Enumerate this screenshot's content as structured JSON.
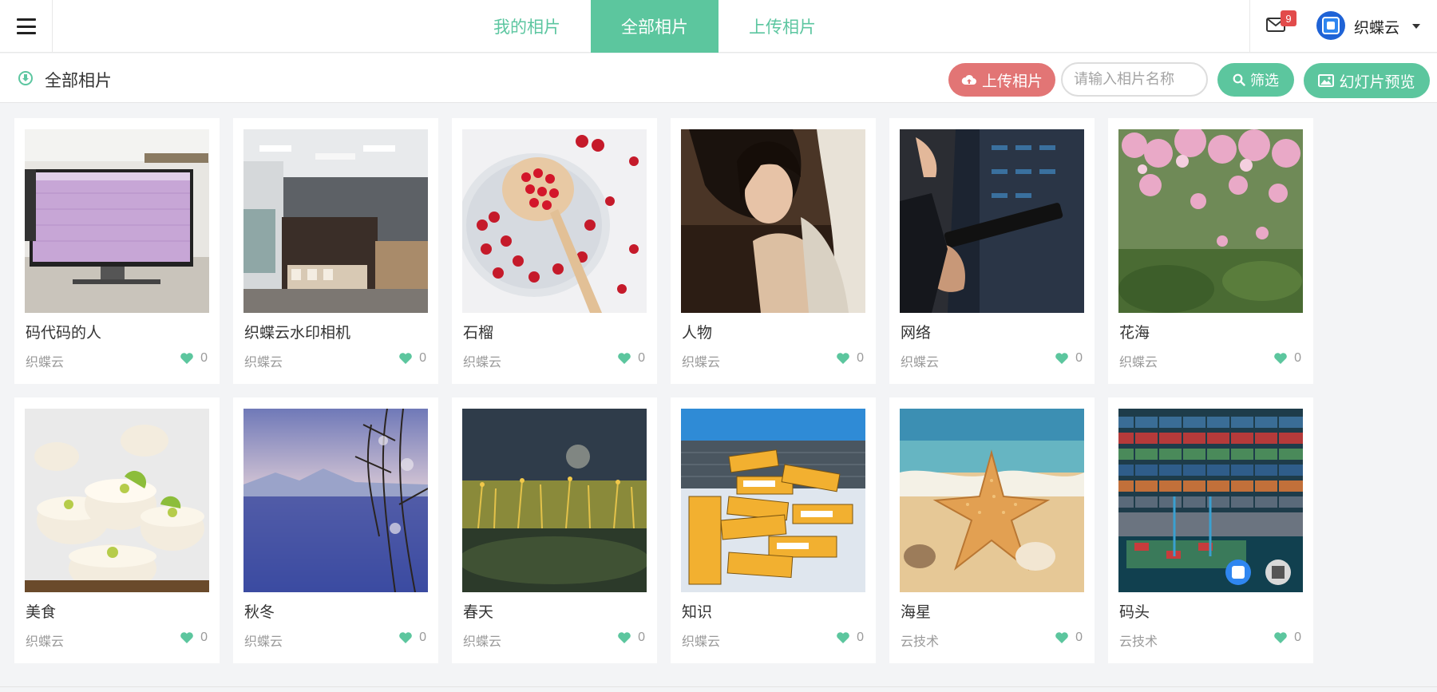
{
  "nav": {
    "tabs": [
      {
        "label": "我的相片",
        "active": false
      },
      {
        "label": "全部相片",
        "active": true
      },
      {
        "label": "上传相片",
        "active": false
      }
    ],
    "mail_badge": "9",
    "username": "织蝶云"
  },
  "subheader": {
    "title": "全部相片",
    "upload_label": "上传相片",
    "search_placeholder": "请输入相片名称",
    "filter_label": "筛选",
    "slideshow_label": "幻灯片预览"
  },
  "colors": {
    "accent": "#5cc69e",
    "upload": "#e27575",
    "badge": "#e24b4b"
  },
  "photos": [
    {
      "title": "码代码的人",
      "author": "织蝶云",
      "likes": "0",
      "thumb": "monitor-photo"
    },
    {
      "title": "织蝶云水印相机",
      "author": "织蝶云",
      "likes": "0",
      "thumb": "office-photo"
    },
    {
      "title": "石榴",
      "author": "织蝶云",
      "likes": "0",
      "thumb": "pomegranate-photo"
    },
    {
      "title": "人物",
      "author": "织蝶云",
      "likes": "0",
      "thumb": "person-photo"
    },
    {
      "title": "网络",
      "author": "织蝶云",
      "likes": "0",
      "thumb": "server-photo"
    },
    {
      "title": "花海",
      "author": "织蝶云",
      "likes": "0",
      "thumb": "blossom-photo"
    },
    {
      "title": "美食",
      "author": "织蝶云",
      "likes": "0",
      "thumb": "dessert-photo"
    },
    {
      "title": "秋冬",
      "author": "织蝶云",
      "likes": "0",
      "thumb": "lake-photo"
    },
    {
      "title": "春天",
      "author": "织蝶云",
      "likes": "0",
      "thumb": "moss-photo"
    },
    {
      "title": "知识",
      "author": "织蝶云",
      "likes": "0",
      "thumb": "binders-photo"
    },
    {
      "title": "海星",
      "author": "云技术",
      "likes": "0",
      "thumb": "starfish-photo"
    },
    {
      "title": "码头",
      "author": "云技术",
      "likes": "0",
      "thumb": "port-photo"
    }
  ]
}
